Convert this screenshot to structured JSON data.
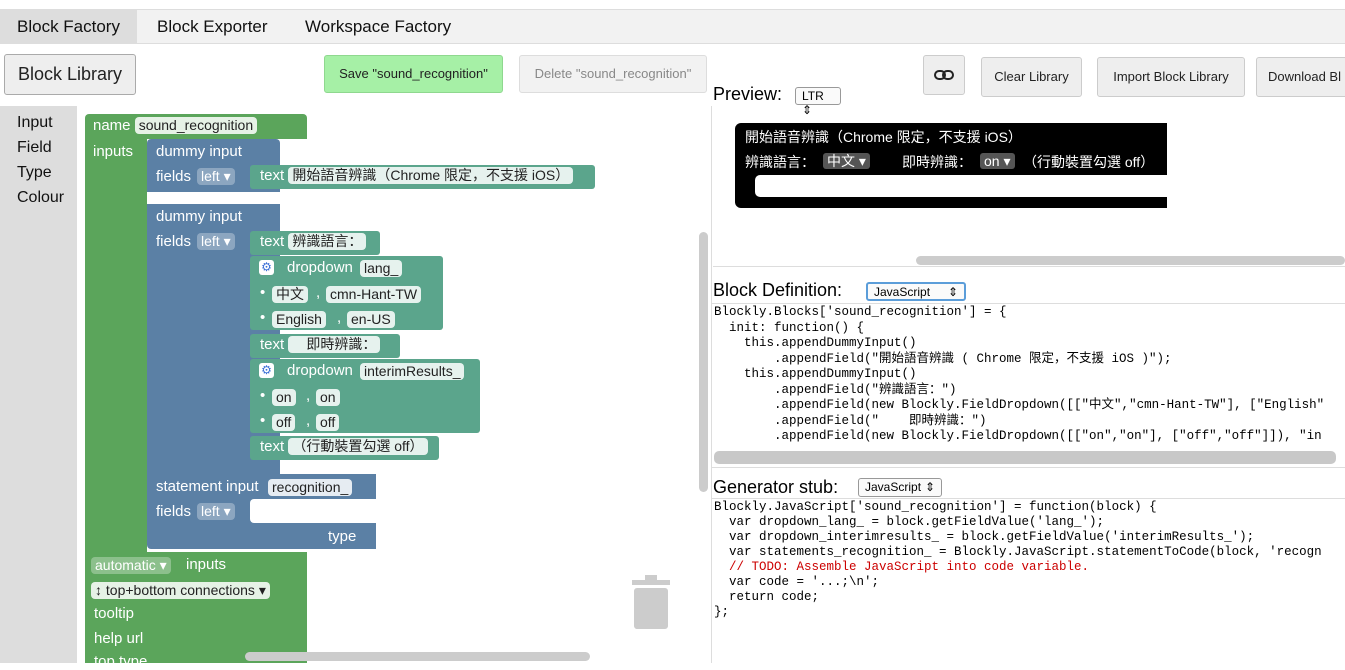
{
  "tabs": [
    "Block Factory",
    "Block Exporter",
    "Workspace Factory"
  ],
  "toolbar": {
    "block_library": "Block Library",
    "save": "Save \"sound_recognition\"",
    "delete": "Delete \"sound_recognition\"",
    "link_icon": "link-icon",
    "clear_library": "Clear Library",
    "import_library": "Import Block Library",
    "download": "Download Bl"
  },
  "toolbox": [
    "Input",
    "Field",
    "Type",
    "Colour"
  ],
  "blocks": {
    "name_label": "name",
    "name_value": "sound_recognition",
    "inputs_label": "inputs",
    "dummy_input": "dummy input",
    "fields_label": "fields",
    "left": "left",
    "text_label": "text",
    "text1": "開始語音辨識（Chrome 限定，不支援 iOS）",
    "text2": "辨識語言：",
    "dropdown_label": "dropdown",
    "dropdown1_name": "lang_",
    "opt1_a": "中文",
    "opt1_b": "cmn-Hant-TW",
    "opt2_a": "English",
    "opt2_b": "en-US",
    "text3": "　即時辨識：",
    "dropdown2_name": "interimResults_",
    "opt3_a": "on",
    "opt3_b": "on",
    "opt4_a": "off",
    "opt4_b": "off",
    "text4": "（行動裝置勾選 off）",
    "statement_input": "statement input",
    "statement_name": "recognition_",
    "type_label": "type",
    "automatic": "automatic",
    "inputs_word": "inputs",
    "connections": "↕ top+bottom connections",
    "tooltip": "tooltip",
    "help_url": "help url",
    "top_type": "top type",
    "comma": ","
  },
  "preview": {
    "title": "Preview:",
    "direction": "LTR",
    "line1": "開始語音辨識（Chrome 限定，不支援 iOS）",
    "label2": "辨識語言：",
    "dd1": "中文",
    "label3": "即時辨識：",
    "dd2": "on",
    "label4": "（行動裝置勾選 off）"
  },
  "block_definition": {
    "title": "Block Definition:",
    "format": "JavaScript",
    "lines": [
      "Blockly.Blocks['sound_recognition'] = {",
      "  init: function() {",
      "    this.appendDummyInput()",
      "        .appendField(\"開始語音辨識 ( Chrome 限定，不支援 iOS )\");",
      "    this.appendDummyInput()",
      "        .appendField(\"辨識語言：\")",
      "        .appendField(new Blockly.FieldDropdown([[\"中文\",\"cmn-Hant-TW\"], [\"English\"",
      "        .appendField(\"    即時辨識：\")",
      "        .appendField(new Blockly.FieldDropdown([[\"on\",\"on\"], [\"off\",\"off\"]]), \"in"
    ]
  },
  "generator": {
    "title": "Generator stub:",
    "format": "JavaScript",
    "lines": [
      "Blockly.JavaScript['sound_recognition'] = function(block) {",
      "  var dropdown_lang_ = block.getFieldValue('lang_');",
      "  var dropdown_interimresults_ = block.getFieldValue('interimResults_');",
      "  var statements_recognition_ = Blockly.JavaScript.statementToCode(block, 'recogn",
      "  // TODO: Assemble JavaScript into code variable.",
      "  var code = '...;\\n';",
      "  return code;",
      "};"
    ]
  },
  "colors": {
    "factory_green": "#5ba55b",
    "input_blue": "#5b80a5",
    "field_teal": "#5ba58c",
    "save_green": "#a6f0a6"
  }
}
